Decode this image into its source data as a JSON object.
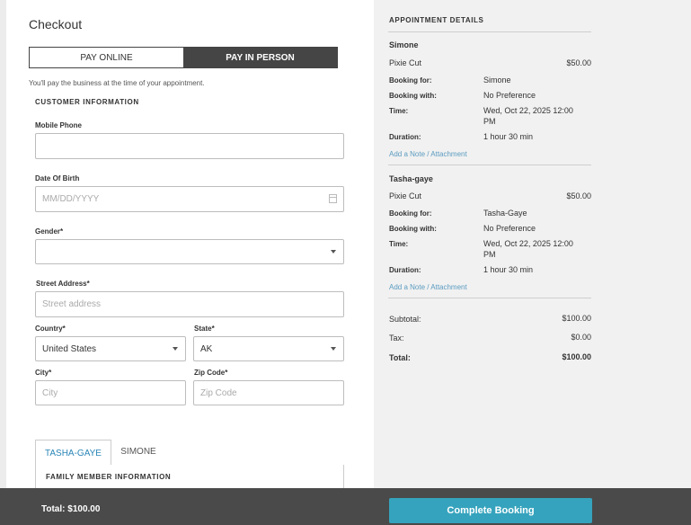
{
  "checkout": {
    "title": "Checkout",
    "pay_online": "PAY ONLINE",
    "pay_in_person": "PAY IN PERSON",
    "note": "You'll pay the business at the time of your appointment.",
    "customer_info_heading": "CUSTOMER INFORMATION",
    "fields": {
      "mobile_phone": {
        "label": "Mobile Phone",
        "value": "",
        "placeholder": ""
      },
      "dob": {
        "label": "Date Of Birth",
        "placeholder": "MM/DD/YYYY"
      },
      "gender": {
        "label": "Gender*",
        "value": ""
      },
      "street": {
        "label": "Street Address*",
        "placeholder": "Street address"
      },
      "country": {
        "label": "Country*",
        "value": "United States"
      },
      "state": {
        "label": "State*",
        "value": "AK"
      },
      "city": {
        "label": "City*",
        "placeholder": "City"
      },
      "zip": {
        "label": "Zip Code*",
        "placeholder": "Zip Code"
      }
    },
    "tabs": [
      "TASHA-GAYE",
      "SIMONE"
    ],
    "family_heading": "FAMILY MEMBER INFORMATION"
  },
  "appointment": {
    "heading": "APPOINTMENT DETAILS",
    "bookings": [
      {
        "name": "Simone",
        "service": "Pixie Cut",
        "price": "$50.00",
        "rows": [
          {
            "label": "Booking for:",
            "value": "Simone"
          },
          {
            "label": "Booking with:",
            "value": "No Preference"
          },
          {
            "label": "Time:",
            "value": "Wed, Oct 22, 2025 12:00",
            "value2": "PM"
          },
          {
            "label": "Duration:",
            "value": "1 hour 30 min"
          }
        ],
        "add_note": "Add a Note / Attachment"
      },
      {
        "name": "Tasha-gaye",
        "service": "Pixie Cut",
        "price": "$50.00",
        "rows": [
          {
            "label": "Booking for:",
            "value": "Tasha-Gaye"
          },
          {
            "label": "Booking with:",
            "value": "No Preference"
          },
          {
            "label": "Time:",
            "value": "Wed, Oct 22, 2025 12:00",
            "value2": "PM"
          },
          {
            "label": "Duration:",
            "value": "1 hour 30 min"
          }
        ],
        "add_note": "Add a Note / Attachment"
      }
    ],
    "summary": {
      "subtotal_label": "Subtotal:",
      "subtotal": "$100.00",
      "tax_label": "Tax:",
      "tax": "$0.00",
      "total_label": "Total:",
      "total": "$100.00"
    }
  },
  "footer": {
    "total": "Total: $100.00",
    "cta": "Complete Booking"
  },
  "colors": {
    "accent": "#35a3bd",
    "link": "#5a9bc0",
    "dark": "#454545"
  }
}
